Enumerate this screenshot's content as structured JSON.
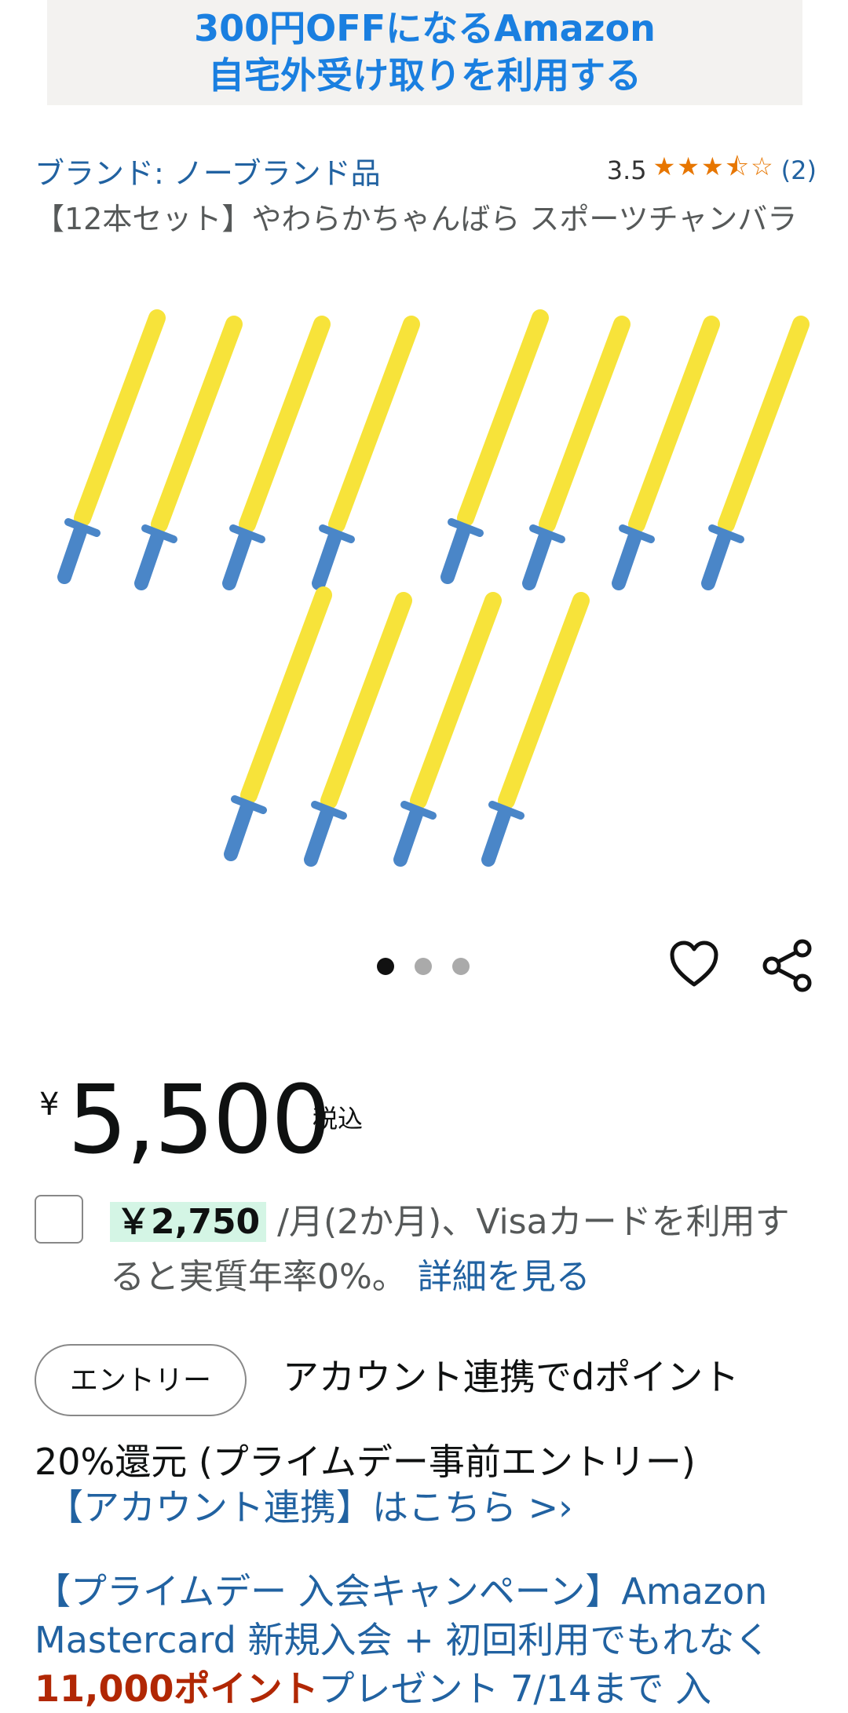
{
  "banner": {
    "line1": "300円OFFになるAmazon",
    "line2": "自宅外受け取りを利用する"
  },
  "product": {
    "brand": "ブランド: ノーブランド品",
    "rating_value": "3.5",
    "rating_stars": 3.5,
    "rating_count": "(2)",
    "title": "【12本セット】やわらかちゃんばら スポーツチャンバラ"
  },
  "carousel": {
    "total": 3,
    "active": 1
  },
  "price": {
    "currency": "¥",
    "amount": "5,500",
    "tax_label": "税込"
  },
  "installment": {
    "amount": "￥2,750",
    "text": " /月(2か月)、Visaカードを利用すると実質年率0%。",
    "link": "詳細を見る"
  },
  "entry": {
    "button_label": "エントリー",
    "text_line1": "アカウント連携でdポイント",
    "text_line2": "20%還元 (プライムデー事前エントリー)",
    "link": "【アカウント連携】はこちら >›"
  },
  "promo": {
    "text_a": "【プライムデー 入会キャンペーン】Amazon Mastercard 新規入会 + 初回利用でもれなく",
    "text_red": "11,000ポイント",
    "text_b": "プレゼント 7/14まで 入"
  },
  "colors": {
    "link": "#2162a1",
    "star": "#e77600",
    "banner_text": "#1a7fe0",
    "sword_blade": "#f7e33a",
    "sword_handle": "#4a86c8"
  },
  "icons": {
    "wishlist": "heart-icon",
    "share": "share-icon"
  }
}
